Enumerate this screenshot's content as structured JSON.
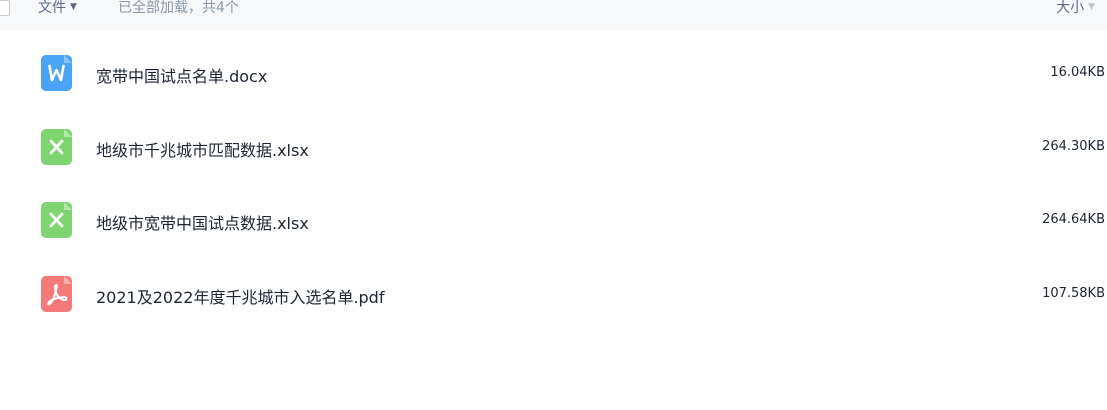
{
  "header": {
    "name_column_label": "文件",
    "loaded_status": "已全部加载，共4个",
    "size_column_label": "大小"
  },
  "files": [
    {
      "name": "宽带中国试点名单.docx",
      "size": "16.04KB",
      "type": "word",
      "icon": "word-file-icon",
      "color": "#4aa3f5"
    },
    {
      "name": "地级市千兆城市匹配数据.xlsx",
      "size": "264.30KB",
      "type": "excel",
      "icon": "excel-file-icon",
      "color": "#7ed56f"
    },
    {
      "name": "地级市宽带中国试点数据.xlsx",
      "size": "264.64KB",
      "type": "excel",
      "icon": "excel-file-icon",
      "color": "#7ed56f"
    },
    {
      "name": "2021及2022年度千兆城市入选名单.pdf",
      "size": "107.58KB",
      "type": "pdf",
      "icon": "pdf-file-icon",
      "color": "#f47a7a"
    }
  ]
}
